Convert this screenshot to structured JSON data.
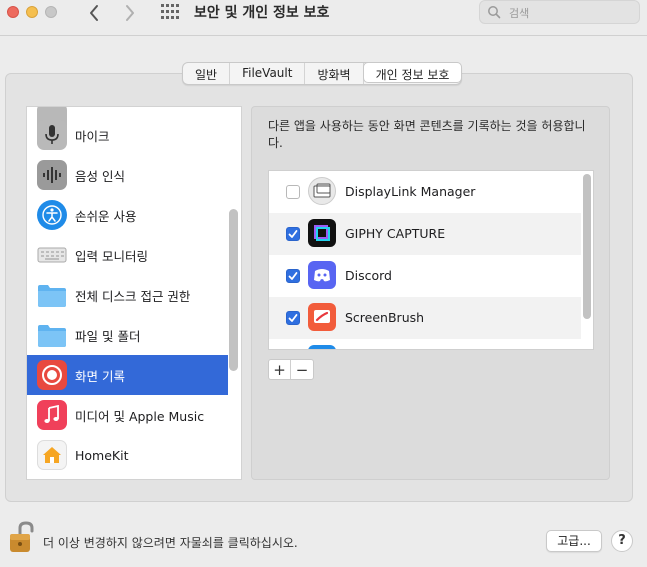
{
  "window": {
    "title": "보안 및 개인 정보 보호",
    "search_placeholder": "검색"
  },
  "tabs": [
    {
      "label": "일반",
      "active": false
    },
    {
      "label": "FileVault",
      "active": false
    },
    {
      "label": "방화벽",
      "active": false
    },
    {
      "label": "개인 정보 보호",
      "active": true
    }
  ],
  "sidebar": {
    "items": [
      {
        "label": "마이크",
        "icon": "microphone-icon"
      },
      {
        "label": "음성 인식",
        "icon": "speech-recognition-icon"
      },
      {
        "label": "손쉬운 사용",
        "icon": "accessibility-icon"
      },
      {
        "label": "입력 모니터링",
        "icon": "keyboard-icon"
      },
      {
        "label": "전체 디스크 접근 권한",
        "icon": "folder-icon"
      },
      {
        "label": "파일 및 폴더",
        "icon": "folder-icon"
      },
      {
        "label": "화면 기록",
        "icon": "screen-recording-icon",
        "selected": true
      },
      {
        "label": "미디어 및 Apple Music",
        "icon": "music-icon"
      },
      {
        "label": "HomeKit",
        "icon": "homekit-icon"
      }
    ]
  },
  "detail": {
    "description": "다른 앱을 사용하는 동안 화면 콘텐츠를 기록하는 것을 허용합니다.",
    "apps": [
      {
        "name": "DisplayLink Manager",
        "checked": false
      },
      {
        "name": "GIPHY CAPTURE",
        "checked": true
      },
      {
        "name": "Discord",
        "checked": true
      },
      {
        "name": "ScreenBrush",
        "checked": true
      }
    ],
    "add_label": "+",
    "remove_label": "−"
  },
  "footer": {
    "lock_text": "더 이상 변경하지 않으려면 자물쇠를 클릭하십시오.",
    "advanced_label": "고급...",
    "help_label": "?"
  },
  "colors": {
    "selection": "#3369d8",
    "checkbox": "#2f6fe0"
  }
}
